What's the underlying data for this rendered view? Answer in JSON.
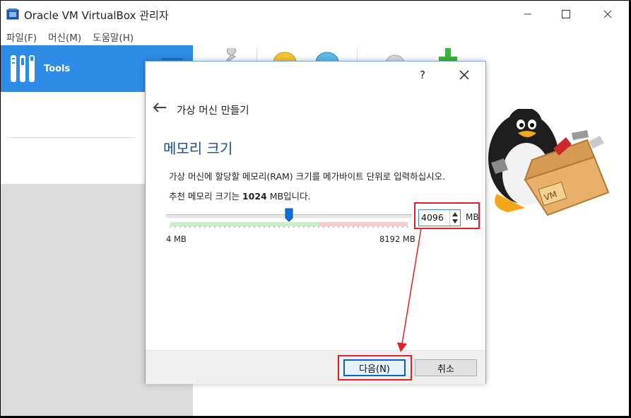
{
  "window": {
    "title": "Oracle VM VirtualBox 관리자",
    "controls": [
      "minimize-icon",
      "maximize-icon",
      "close-icon"
    ]
  },
  "menubar": {
    "items": [
      "파일(F)",
      "머신(M)",
      "도움말(H)"
    ]
  },
  "sidebar": {
    "tools_label": "Tools"
  },
  "dialog": {
    "help_label": "?",
    "title": "가상 머신 만들기",
    "section_title": "메모리 크기",
    "description": "가상 머신에 할당할 메모리(RAM) 크기를 메가바이트 단위로 입력하십시오.",
    "recommend_prefix": "추천 메모리 크기는 ",
    "recommend_value": "1024",
    "recommend_suffix": " MB입니다.",
    "slider": {
      "min_label": "4 MB",
      "max_label": "8192 MB",
      "min": 4,
      "max": 8192,
      "value": 4096,
      "recommended_limit": 5120
    },
    "memory_input": {
      "value": "4096",
      "unit": "MB"
    },
    "buttons": {
      "next": "다음(N)",
      "cancel": "취소"
    }
  },
  "colors": {
    "accent": "#2e8be6",
    "highlight": "#e0202a",
    "section_title": "#1c4a93"
  }
}
